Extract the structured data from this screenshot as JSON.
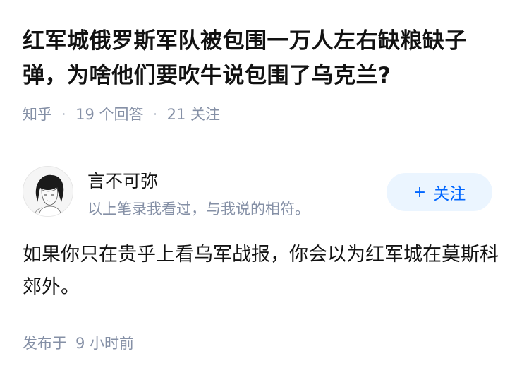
{
  "question": {
    "title": "红军城俄罗斯军队被包围一万人左右缺粮缺子弹，为啥他们要吹牛说包围了乌克兰?",
    "source": "知乎",
    "answer_count": "19 个回答",
    "follower_count": "21 关注",
    "separator": "·"
  },
  "author": {
    "name": "言不可弥",
    "bio": "以上笔录我看过，与我说的相符。",
    "follow_label": "关注",
    "follow_icon": "+"
  },
  "answer": {
    "text": "如果你只在贵乎上看乌军战报，你会以为红军城在莫斯科郊外。"
  },
  "footer": {
    "published_label": "发布于",
    "published_time": "9 小时前"
  },
  "colors": {
    "title": "#121212",
    "meta": "#8590a6",
    "accent": "#0066ff",
    "follow_bg": "#ebf5ff",
    "divider": "#ebebeb"
  }
}
